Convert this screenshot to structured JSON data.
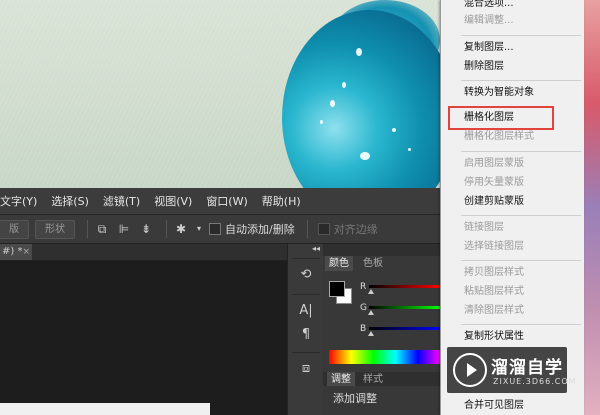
{
  "menubar": {
    "items": [
      "文字(Y)",
      "选择(S)",
      "滤镜(T)",
      "视图(V)",
      "窗口(W)",
      "帮助(H)"
    ]
  },
  "optbar": {
    "btn1": "版",
    "btn2": "形状",
    "auto_add_delete": "自动添加/删除",
    "align_edges": "对齐边缘"
  },
  "doc_tab": {
    "label": "#) *",
    "close": "×"
  },
  "color_panel": {
    "tab_color": "颜色",
    "tab_swatches": "色板",
    "r_label": "R",
    "g_label": "G",
    "b_label": "B",
    "tab_adjust": "调整",
    "tab_styles": "样式",
    "adjust_title": "添加调整"
  },
  "context_menu": {
    "items": [
      {
        "label": "混合选项...",
        "enabled": true
      },
      {
        "label": "编辑调整...",
        "enabled": false
      },
      {
        "label": "复制图层...",
        "enabled": true
      },
      {
        "label": "删除图层",
        "enabled": true
      },
      {
        "label": "转换为智能对象",
        "enabled": true
      },
      {
        "label": "栅格化图层",
        "enabled": true
      },
      {
        "label": "栅格化图层样式",
        "enabled": false
      },
      {
        "label": "启用图层蒙版",
        "enabled": false
      },
      {
        "label": "停用矢量蒙版",
        "enabled": false
      },
      {
        "label": "创建剪贴蒙版",
        "enabled": true
      },
      {
        "label": "链接图层",
        "enabled": false
      },
      {
        "label": "选择链接图层",
        "enabled": false
      },
      {
        "label": "拷贝图层样式",
        "enabled": false
      },
      {
        "label": "粘贴图层样式",
        "enabled": false
      },
      {
        "label": "清除图层样式",
        "enabled": false
      },
      {
        "label": "复制形状属性",
        "enabled": true
      },
      {
        "label": "合并可见图层",
        "enabled": true
      }
    ]
  },
  "watermark": {
    "name": "溜溜自学",
    "url": "ZIXUE.3D66.COM"
  },
  "colors": {
    "highlight_box": "#e0443a",
    "menu_bg": "#f0f0f0",
    "menubar_bg": "#3c3c3c"
  },
  "icons": {
    "tool_combine": "path-ops-icon",
    "tool_align": "path-align-icon",
    "tool_arrange": "path-arrange-icon",
    "tool_gear": "gear-icon",
    "strip_history": "history-icon",
    "strip_character": "character-icon",
    "strip_paragraph": "paragraph-icon",
    "strip_3d": "3d-icon",
    "watermark_logo": "play-icon"
  }
}
